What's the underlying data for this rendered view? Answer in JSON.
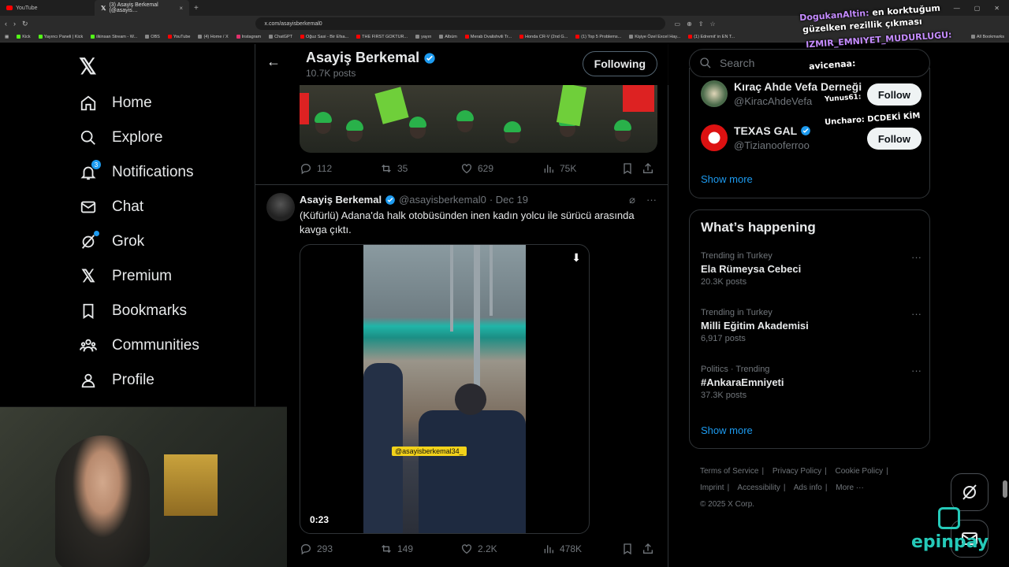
{
  "browser": {
    "tabs": [
      {
        "title": "YouTube",
        "icon": "youtube-icon"
      },
      {
        "title": "(3) Asayiş Berkemal (@asayis…",
        "icon": "x-icon"
      }
    ],
    "url": "x.com/asayisberkemal0",
    "bookmarks": [
      "Kick",
      "Yayıncı Paneli | Kick",
      "ilkinsan Stream - W...",
      "OBS",
      "YouTube",
      "(4) Home / X",
      "Instagram",
      "ChatGPT",
      "Oğuz Sasi - Bir Efsa...",
      "THE FIRST GOKTUR...",
      "yayın",
      "Albüm",
      "Merab Dvalishvili Tr...",
      "Honda CR-V (2nd G...",
      "(1) Top 5 Problems...",
      "Kişiye Özel Excel Hay...",
      "(1) Edremit' in EN T...",
      "All Bookmarks"
    ]
  },
  "nav": {
    "items": [
      {
        "label": "Home",
        "icon": "home-icon"
      },
      {
        "label": "Explore",
        "icon": "search-icon"
      },
      {
        "label": "Notifications",
        "icon": "bell-icon",
        "badge": "3"
      },
      {
        "label": "Chat",
        "icon": "mail-icon"
      },
      {
        "label": "Grok",
        "icon": "grok-icon"
      },
      {
        "label": "Premium",
        "icon": "x-icon"
      },
      {
        "label": "Bookmarks",
        "icon": "bookmark-icon"
      },
      {
        "label": "Communities",
        "icon": "communities-icon"
      },
      {
        "label": "Profile",
        "icon": "profile-icon"
      }
    ]
  },
  "profile_header": {
    "name": "Asayiş Berkemal",
    "posts": "10.7K posts",
    "follow_label": "Following"
  },
  "prev_tweet": {
    "replies": "112",
    "reposts": "35",
    "likes": "629",
    "views": "75K"
  },
  "tweet": {
    "name": "Asayiş Berkemal",
    "handle": "@asayisberkemal0",
    "date": "· Dec 19",
    "text": "(Küfürlü) Adana'da halk otobüsünden inen kadın yolcu ile sürücü arasında kavga çıktı.",
    "video_watermark": "@asayisberkemal34_",
    "video_duration": "0:23",
    "replies": "293",
    "reposts": "149",
    "likes": "2.2K",
    "views": "478K"
  },
  "search": {
    "placeholder": "Search"
  },
  "who_to_follow": {
    "accounts": [
      {
        "name": "Kıraç Ahde Vefa Derneği",
        "handle": "@KiracAhdeVefa",
        "follow": "Follow"
      },
      {
        "name": "TEXAS GAL",
        "handle": "@Tizianooferroo",
        "follow": "Follow"
      }
    ],
    "show_more": "Show more"
  },
  "happening": {
    "title": "What’s happening",
    "trends": [
      {
        "context": "Trending in Turkey",
        "name": "Ela Rümeysa Cebeci",
        "count": "20.3K posts"
      },
      {
        "context": "Trending in Turkey",
        "name": "Milli Eğitim Akademisi",
        "count": "6,917 posts"
      },
      {
        "context": "Politics · Trending",
        "name": "#AnkaraEmniyeti",
        "count": "37.3K posts"
      }
    ],
    "show_more": "Show more"
  },
  "footer": {
    "links": [
      "Terms of Service",
      "Privacy Policy",
      "Cookie Policy",
      "Imprint",
      "Accessibility",
      "Ads info",
      "More ···"
    ],
    "copyright": "© 2025 X Corp."
  },
  "overlay": {
    "chat": [
      {
        "user": "DogukanAltin:",
        "msg": "en korktuğum"
      },
      {
        "user": "",
        "msg": "güzelken rezillik çıkması"
      },
      {
        "user": "IZMIR_EMNIYET_MUDURLUGU:",
        "msg": ""
      },
      {
        "user": "avicenaa:",
        "msg": ""
      },
      {
        "user": "Yunus61:",
        "msg": ""
      },
      {
        "user": "Uncharo:",
        "msg": "DCDEKİ KİM"
      }
    ],
    "sponsor": "epinpay"
  },
  "colors": {
    "accent": "#1d9bf0",
    "background": "#000000",
    "border": "#2f3336"
  }
}
